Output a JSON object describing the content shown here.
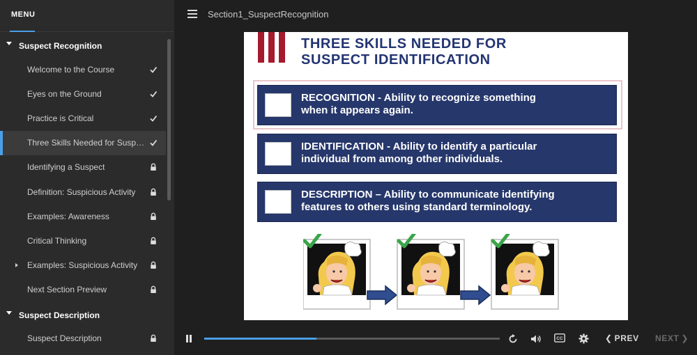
{
  "sidebar": {
    "menu_label": "MENU",
    "sections": [
      {
        "title": "Suspect Recognition",
        "lessons": [
          {
            "title": "Welcome to the Course",
            "status": "complete"
          },
          {
            "title": "Eyes on the Ground",
            "status": "complete"
          },
          {
            "title": "Practice is Critical",
            "status": "complete"
          },
          {
            "title": "Three Skills Needed for Suspect Identification",
            "status": "complete",
            "active": true
          },
          {
            "title": "Identifying a Suspect",
            "status": "locked"
          },
          {
            "title": "Definition: Suspicious Activity",
            "status": "locked"
          },
          {
            "title": "Examples: Awareness",
            "status": "locked"
          },
          {
            "title": "Critical Thinking",
            "status": "locked"
          },
          {
            "title": "Examples: Suspicious Activity",
            "status": "locked",
            "expandable": true
          },
          {
            "title": "Next Section Preview",
            "status": "locked"
          }
        ]
      },
      {
        "title": "Suspect Description",
        "lessons": [
          {
            "title": "Suspect Description",
            "status": "locked"
          }
        ]
      }
    ]
  },
  "topbar": {
    "title": "Section1_SuspectRecognition"
  },
  "slide": {
    "title_line1": "THREE SKILLS NEEDED FOR",
    "title_line2": "SUSPECT IDENTIFICATION",
    "skills": [
      {
        "line1": "RECOGNITION - Ability to recognize something",
        "line2": "when it appears again."
      },
      {
        "line1": "IDENTIFICATION - Ability to identify a particular",
        "line2": "individual from among other individuals."
      },
      {
        "line1": "DESCRIPTION – Ability to communicate identifying",
        "line2": "features to others using standard terminology."
      }
    ]
  },
  "player": {
    "progress": 0.38,
    "prev_label": "PREV",
    "next_label": "NEXT",
    "icons": [
      "pause-icon",
      "replay-icon",
      "volume-icon",
      "closed-captions-icon",
      "settings-icon"
    ]
  },
  "colors": {
    "accent": "#4a9fe8",
    "sidebar_bg": "#2b2b2b",
    "slide_navy": "#26376b",
    "slide_title": "#233473",
    "brand_red": "#a6192e"
  }
}
